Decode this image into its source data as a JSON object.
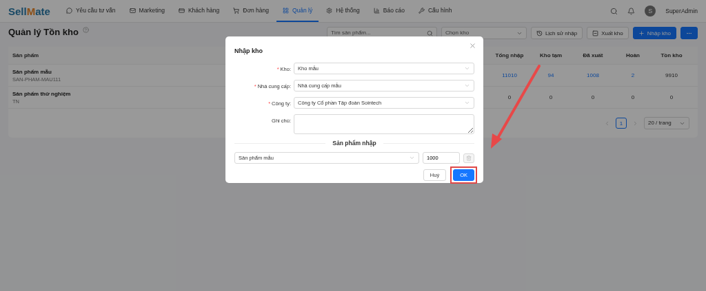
{
  "logo": {
    "left": "Sell",
    "mark": "M",
    "right": "ate"
  },
  "nav": [
    {
      "label": "Yêu cầu tư vấn",
      "selected": false
    },
    {
      "label": "Marketing",
      "selected": false
    },
    {
      "label": "Khách hàng",
      "selected": false
    },
    {
      "label": "Đơn hàng",
      "selected": false
    },
    {
      "label": "Quản lý",
      "selected": true
    },
    {
      "label": "Hệ thống",
      "selected": false
    },
    {
      "label": "Báo cáo",
      "selected": false
    },
    {
      "label": "Cấu hình",
      "selected": false
    }
  ],
  "user": {
    "avatar": "S",
    "name": "SuperAdmin"
  },
  "page_title": "Quản lý Tồn kho",
  "toolbar": {
    "search": {
      "placeholder": "Tìm sản phẩm..."
    },
    "warehouse": {
      "placeholder": "Chọn kho"
    },
    "buttons": [
      {
        "label": "Lịch sử nhập",
        "kind": "history"
      },
      {
        "label": "Xuất kho",
        "kind": "export"
      },
      {
        "label": "Nhập kho",
        "kind": "primary"
      }
    ]
  },
  "table": {
    "columns": [
      "Sản phẩm",
      "Tổng nhập",
      "Kho tạm",
      "Đã xuất",
      "Hoàn",
      "Tồn kho"
    ],
    "rows": [
      {
        "name": "Sản phẩm mẫu",
        "code": "SAN-PHAM-MAU111",
        "values": [
          {
            "text": "11010",
            "link": true
          },
          {
            "text": "94",
            "link": true
          },
          {
            "text": "1008",
            "link": true
          },
          {
            "text": "2",
            "link": true
          },
          {
            "text": "9910",
            "link": false
          }
        ]
      },
      {
        "name": "Sản phẩm thử nghiệm",
        "code": "TN",
        "values": [
          {
            "text": "0",
            "link": false
          },
          {
            "text": "0",
            "link": false
          },
          {
            "text": "0",
            "link": false
          },
          {
            "text": "0",
            "link": false
          },
          {
            "text": "0",
            "link": false
          }
        ]
      }
    ]
  },
  "pagination": {
    "pages": [
      {
        "label": "1",
        "selected": true
      }
    ],
    "page_size": "20 / trang"
  },
  "modal": {
    "title": "Nhập kho",
    "fields": [
      {
        "label": "Kho:",
        "marker": "*",
        "kind": "select",
        "value": "Kho mẫu"
      },
      {
        "label": "Nhà cung cấp:",
        "marker": "*",
        "kind": "select",
        "value": "Nhà cung cấp mẫu"
      },
      {
        "label": "Công ty:",
        "marker": "*",
        "kind": "select",
        "value": "Công ty Cổ phần Tập đoàn Sointech"
      },
      {
        "label": "Ghi chú:",
        "kind": "textarea"
      }
    ],
    "section": "Sản phẩm nhập",
    "product": {
      "value": "Sản phẩm mẫu",
      "quantity": "1000"
    },
    "buttons": [
      {
        "label": "Huỷ",
        "kind": "default"
      },
      {
        "label": "OK",
        "kind": "primary",
        "highlighted": true
      }
    ]
  }
}
